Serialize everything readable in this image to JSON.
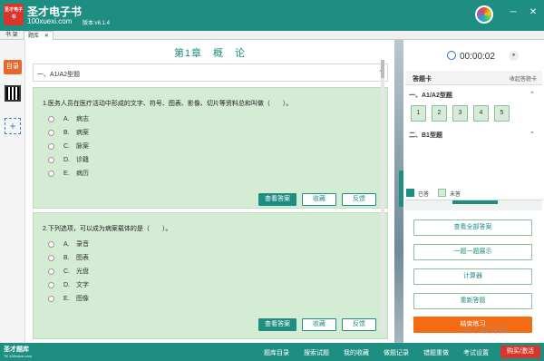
{
  "titlebar": {
    "logo_text": "圣才电子书",
    "app_name": "圣才电子书",
    "site": "100xuexi.com",
    "version": "版本:v6.1.4",
    "min": "─",
    "close": "✕"
  },
  "tabs": {
    "shelf": "书 架",
    "active": "题库",
    "active_close": "✕"
  },
  "left": {
    "dir": "目录",
    "add": "+"
  },
  "main": {
    "chapter_title": "第1章　概　论",
    "section": "一、A1/A2型题",
    "section_chevron": "⌃",
    "q1": {
      "text": "1.医务人员在医疗活动中形成的文字、符号、图表、影像、切片等资料总和叫做（　　）。",
      "options": [
        {
          "letter": "A.",
          "text": "病志"
        },
        {
          "letter": "B.",
          "text": "病案"
        },
        {
          "letter": "C.",
          "text": "脉案"
        },
        {
          "letter": "D.",
          "text": "诊籍"
        },
        {
          "letter": "E.",
          "text": "病历"
        }
      ]
    },
    "q2": {
      "text": "2.下列选项，可以成为病案载体的是（　　）。",
      "options": [
        {
          "letter": "A.",
          "text": "录音"
        },
        {
          "letter": "B.",
          "text": "图表"
        },
        {
          "letter": "C.",
          "text": "光盘"
        },
        {
          "letter": "D.",
          "text": "文字"
        },
        {
          "letter": "E.",
          "text": "图像"
        }
      ]
    },
    "buttons": {
      "view_answer": "查看答案",
      "favorite": "收藏",
      "feedback": "反馈"
    }
  },
  "right": {
    "timer": "00:00:02",
    "pause": "⏸",
    "card_title": "答题卡",
    "card_collapse": "收起答题卡",
    "sec1": "一、A1/A2型题",
    "sec2": "二、B1型题",
    "chevron": "⌃",
    "numbers": [
      "1",
      "2",
      "3",
      "4",
      "5"
    ],
    "legend_answered": "已答",
    "legend_unanswered": "未答",
    "actions": [
      "查看全部答案",
      "一题一题展示",
      "计算器",
      "重新答题"
    ],
    "finish": "结束练习"
  },
  "bottom": {
    "logo": "圣才题库",
    "site": "TK.100xuexi.com",
    "items": [
      "题库目录",
      "搜索试题",
      "我的收藏",
      "做题记录",
      "错题重做",
      "考试设置"
    ],
    "buy": "购买/激活"
  },
  "watermark": "当下软件园",
  "colors": {
    "teal": "#1e8e83",
    "orange": "#f46b14",
    "red": "#d9362b",
    "card_green": "#d4ecd4"
  }
}
